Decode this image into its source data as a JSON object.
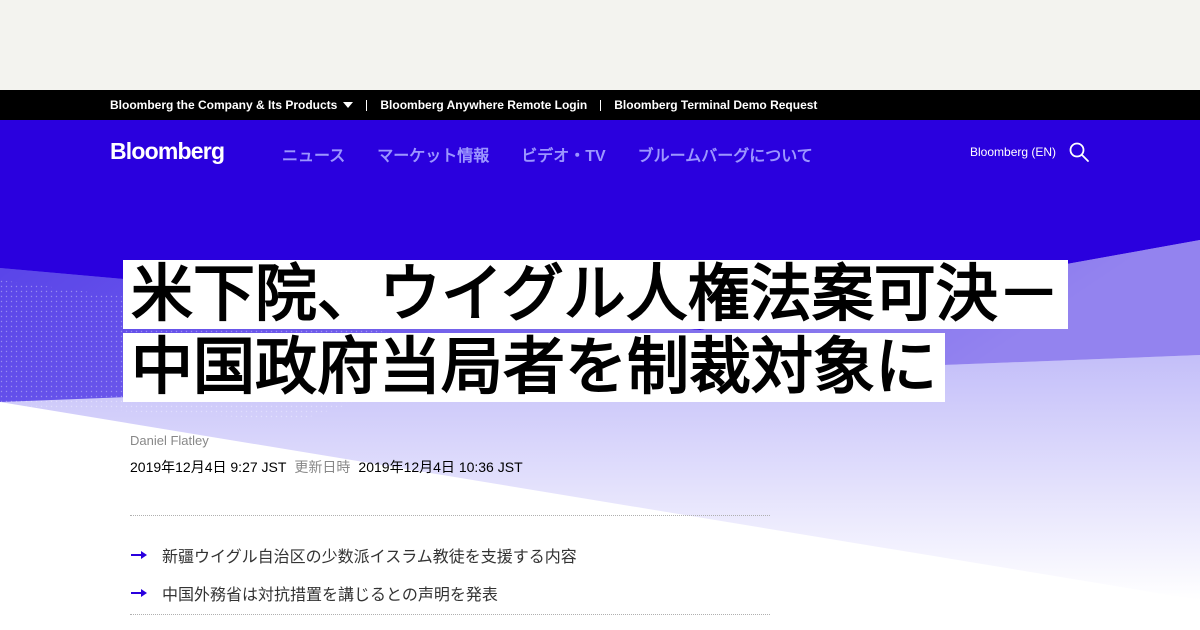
{
  "topbar": {
    "links": [
      {
        "label": "Bloomberg the Company & Its Products"
      },
      {
        "label": "Bloomberg Anywhere Remote Login"
      },
      {
        "label": "Bloomberg Terminal Demo Request"
      }
    ]
  },
  "nav": {
    "logo": "Bloomberg",
    "items": [
      {
        "label": "ニュース"
      },
      {
        "label": "マーケット情報"
      },
      {
        "label": "ビデオ・TV"
      },
      {
        "label": "ブルームバーグについて"
      }
    ],
    "edition": "Bloomberg (EN)",
    "search_icon": "search-icon"
  },
  "colors": {
    "hero": "#2a00de",
    "nav_link": "#9c96ff",
    "bullet_arrow": "#2a00de",
    "topbar": "#000000"
  },
  "article": {
    "headline": "米下院、ウイグル人権法案可決－中国政府当局者を制裁対象に",
    "author": "Daniel Flatley",
    "published": "2019年12月4日 9:27 JST",
    "updated_label": "更新日時",
    "updated": "2019年12月4日 10:36 JST",
    "bullets": [
      {
        "text": "新疆ウイグル自治区の少数派イスラム教徒を支援する内容"
      },
      {
        "text": "中国外務省は対抗措置を講じるとの声明を発表"
      }
    ]
  }
}
